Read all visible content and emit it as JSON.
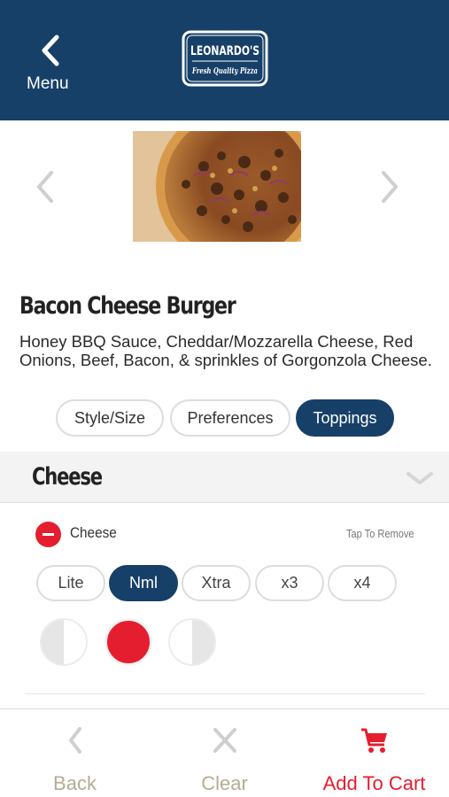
{
  "header": {
    "menu_label": "Menu",
    "logo_name": "LEONARDO'S",
    "logo_tagline": "Fresh Quality Pizza",
    "bg_color": "#174069"
  },
  "item": {
    "title": "Bacon Cheese Burger",
    "description": "Honey BBQ Sauce, Cheddar/Mozzarella Cheese, Red Onions, Beef, Bacon, & sprinkles of Gorgonzola Cheese."
  },
  "tabs": [
    {
      "label": "Style/Size",
      "active": false
    },
    {
      "label": "Preferences",
      "active": false
    },
    {
      "label": "Toppings",
      "active": true
    }
  ],
  "section": {
    "title": "Cheese"
  },
  "topping": {
    "name": "Cheese",
    "action_hint": "Tap To Remove",
    "amounts": [
      "Lite",
      "Nml",
      "Xtra",
      "x3",
      "x4"
    ],
    "selected_amount": "Nml",
    "portion_selected": "whole"
  },
  "bottom_bar": {
    "back_label": "Back",
    "clear_label": "Clear",
    "cart_label": "Add To Cart",
    "accent_color": "#e51e2f",
    "muted_color": "#b7ab96"
  }
}
